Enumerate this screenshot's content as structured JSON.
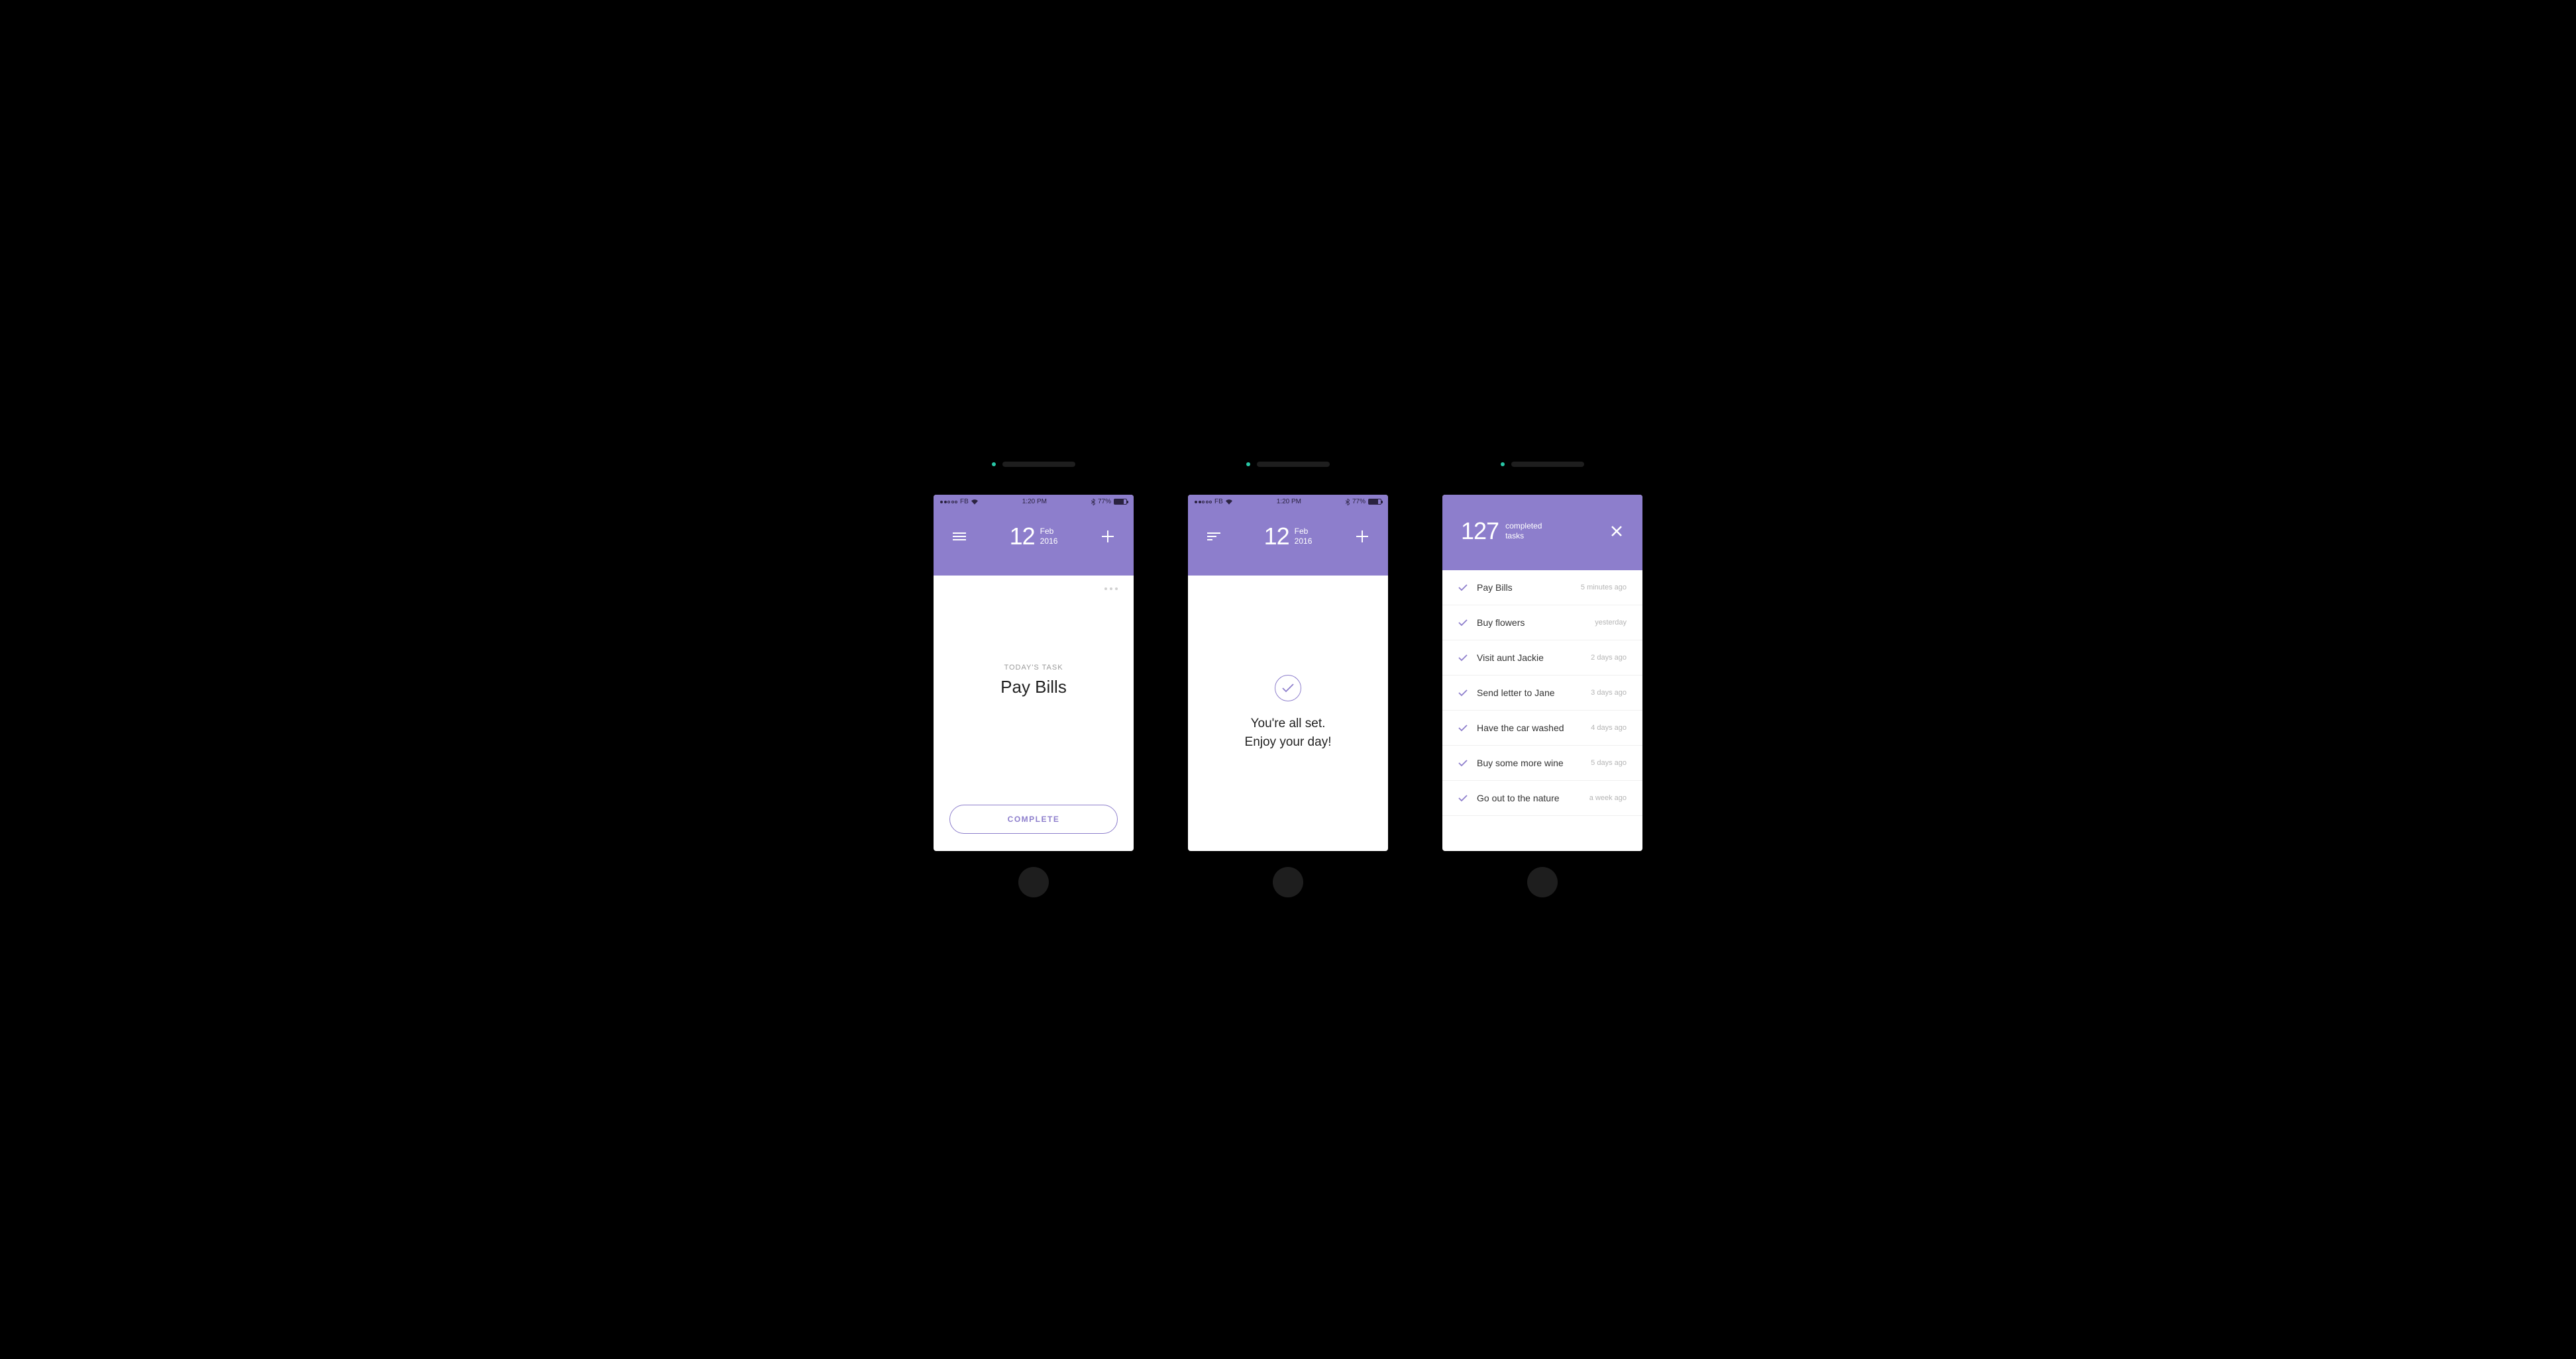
{
  "status": {
    "carrier": "FB",
    "time": "1:20 PM",
    "battery": "77%"
  },
  "header": {
    "day": "12",
    "month": "Feb",
    "year": "2016"
  },
  "screen1": {
    "label": "TODAY'S TASK",
    "task": "Pay Bills",
    "button": "COMPLETE"
  },
  "screen2": {
    "line1": "You're all set.",
    "line2": "Enjoy your day!"
  },
  "screen3": {
    "count": "127",
    "count_label1": "completed",
    "count_label2": "tasks",
    "items": [
      {
        "name": "Pay Bills",
        "time": "5 minutes ago"
      },
      {
        "name": "Buy flowers",
        "time": "yesterday"
      },
      {
        "name": "Visit aunt Jackie",
        "time": "2 days ago"
      },
      {
        "name": "Send letter to Jane",
        "time": "3 days ago"
      },
      {
        "name": "Have the car washed",
        "time": "4 days ago"
      },
      {
        "name": "Buy some more wine",
        "time": "5 days ago"
      },
      {
        "name": "Go out to the nature",
        "time": "a week ago"
      }
    ]
  }
}
